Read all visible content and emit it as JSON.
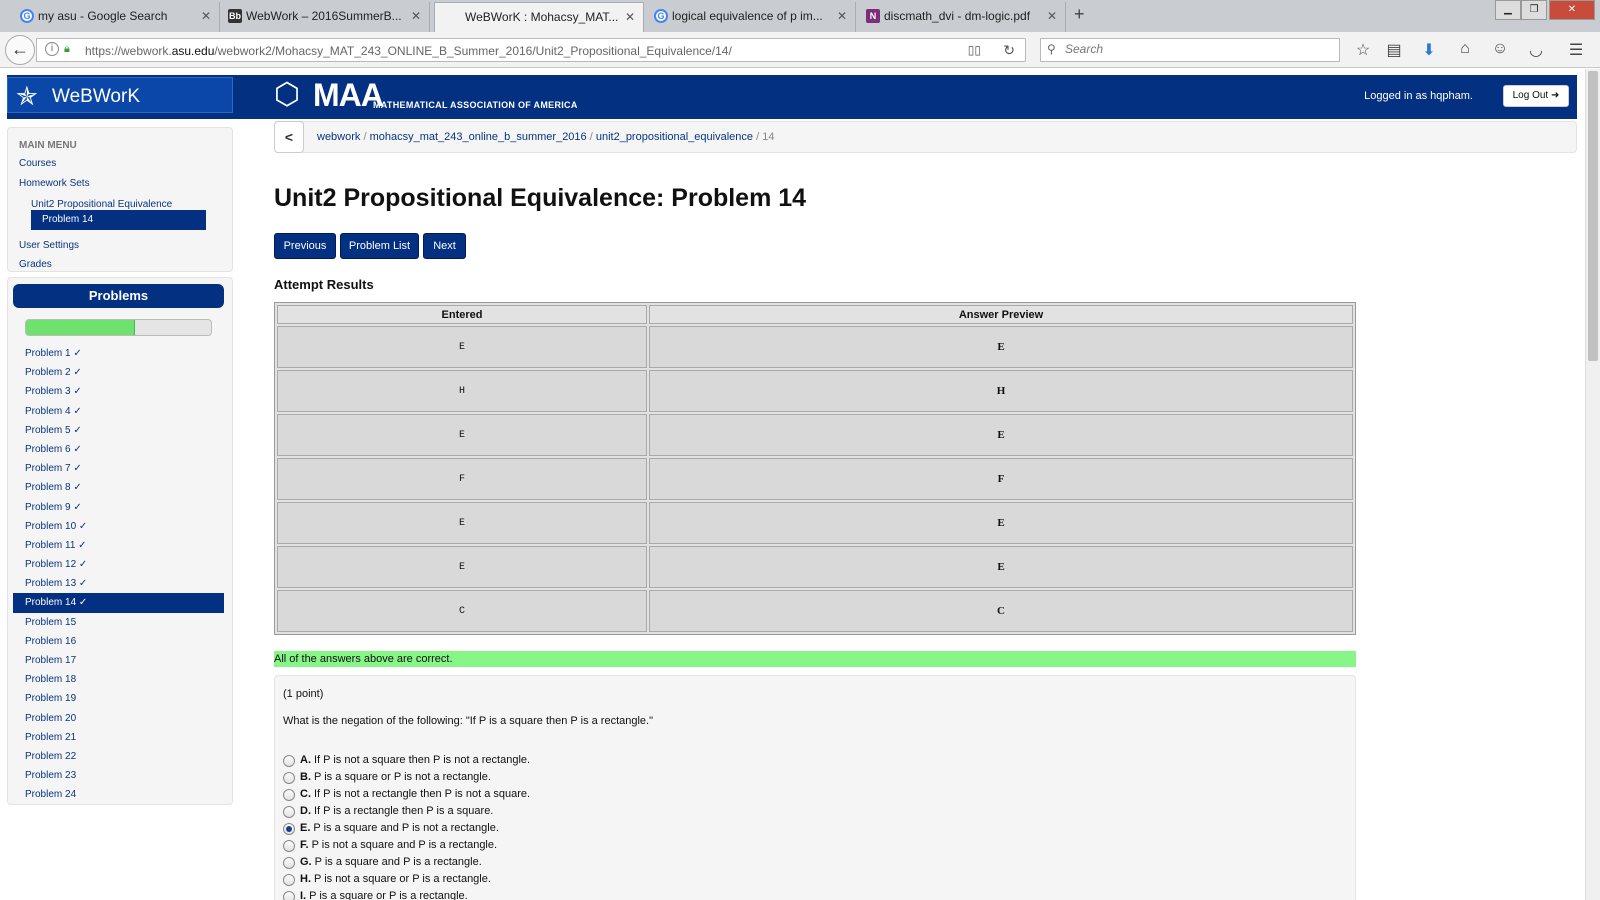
{
  "browser": {
    "tabs": [
      {
        "title": "my asu - Google Search",
        "icon": "google-icon"
      },
      {
        "title": "WebWork – 2016SummerB...",
        "icon": "blackboard-icon"
      },
      {
        "title": "WeBWorK : Mohacsy_MAT...",
        "icon": "none"
      },
      {
        "title": "logical equivalence of p im...",
        "icon": "google-icon"
      },
      {
        "title": "discmath_dvi - dm-logic.pdf",
        "icon": "onenote-icon"
      }
    ],
    "url_prefix": "https://webwork.",
    "url_domain": "asu.edu",
    "url_path": "/webwork2/Mohacsy_MAT_243_ONLINE_B_Summer_2016/Unit2_Propositional_Equivalence/14/",
    "search_placeholder": "Search"
  },
  "header": {
    "brand": "WeBWorK",
    "maa": "MAA",
    "maa_sub": "MATHEMATICAL ASSOCIATION OF AMERICA",
    "logged_in": "Logged in as hqpham.",
    "logout": "Log Out"
  },
  "main_menu": {
    "heading": "MAIN MENU",
    "courses": "Courses",
    "homework_sets": "Homework Sets",
    "set_name": "Unit2 Propositional Equivalence",
    "current_problem": "Problem 14",
    "user_settings": "User Settings",
    "grades": "Grades"
  },
  "problems_panel": {
    "heading": "Problems",
    "progress": 0.59,
    "items": [
      "Problem 1 ✓",
      "Problem 2 ✓",
      "Problem 3 ✓",
      "Problem 4 ✓",
      "Problem 5 ✓",
      "Problem 6 ✓",
      "Problem 7 ✓",
      "Problem 8 ✓",
      "Problem 9 ✓",
      "Problem 10 ✓",
      "Problem 11 ✓",
      "Problem 12 ✓",
      "Problem 13 ✓",
      "Problem 14 ✓",
      "Problem 15",
      "Problem 16",
      "Problem 17",
      "Problem 18",
      "Problem 19",
      "Problem 20",
      "Problem 21",
      "Problem 22",
      "Problem 23",
      "Problem 24"
    ],
    "active_index": 13
  },
  "breadcrumb": {
    "items": [
      "webwork",
      "mohacsy_mat_243_online_b_summer_2016",
      "unit2_propositional_equivalence"
    ],
    "current": "14"
  },
  "page_title": "Unit2 Propositional Equivalence: Problem 14",
  "nav_buttons": {
    "previous": "Previous",
    "problem_list": "Problem List",
    "next": "Next"
  },
  "attempt": {
    "heading": "Attempt Results",
    "columns": [
      "Entered",
      "Answer Preview"
    ],
    "rows": [
      [
        "E",
        "E"
      ],
      [
        "H",
        "H"
      ],
      [
        "E",
        "E"
      ],
      [
        "F",
        "F"
      ],
      [
        "E",
        "E"
      ],
      [
        "E",
        "E"
      ],
      [
        "C",
        "C"
      ]
    ],
    "message": "All of the answers above are correct."
  },
  "problem": {
    "points": "(1 point)",
    "question": "What is the negation of the following: \"If P is a square then P is a rectangle.\"",
    "choices": [
      {
        "letter": "A.",
        "text": "If P is not a square then P is not a rectangle."
      },
      {
        "letter": "B.",
        "text": "P is a square or P is not a rectangle."
      },
      {
        "letter": "C.",
        "text": "If P is not a rectangle then P is not a square."
      },
      {
        "letter": "D.",
        "text": "If P is a rectangle then P is a square."
      },
      {
        "letter": "E.",
        "text": "P is a square and P is not a rectangle."
      },
      {
        "letter": "F.",
        "text": "P is not a square and P is a rectangle."
      },
      {
        "letter": "G.",
        "text": "P is a square and P is a rectangle."
      },
      {
        "letter": "H.",
        "text": "P is not a square or P is a rectangle."
      },
      {
        "letter": "I.",
        "text": "P is a square or P is a rectangle."
      }
    ],
    "selected_index": 4
  }
}
